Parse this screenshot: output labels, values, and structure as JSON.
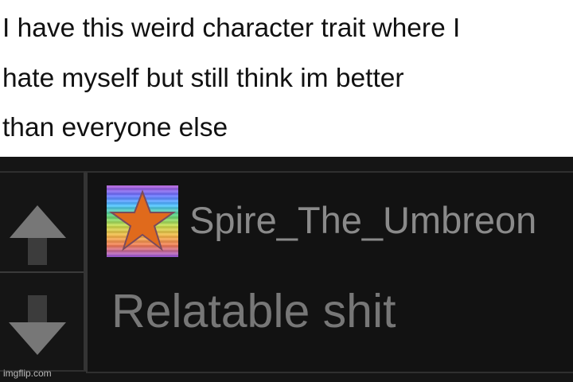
{
  "post": {
    "lines": [
      "I have this weird character trait where I",
      "hate myself but still think im better",
      "than everyone else"
    ]
  },
  "comment": {
    "username": "Spire_The_Umbreon",
    "text": "Relatable shit",
    "avatar_icon": "rainbow-star-avatar-icon"
  },
  "votes": {
    "up_icon": "upvote-arrow-icon",
    "down_icon": "downvote-arrow-icon"
  },
  "watermark": "imgflip.com",
  "colors": {
    "panel_background": "#151515",
    "username": "#8a8a8a",
    "comment_text": "#777777",
    "star": "#e06a1c",
    "arrow": "#777777"
  }
}
